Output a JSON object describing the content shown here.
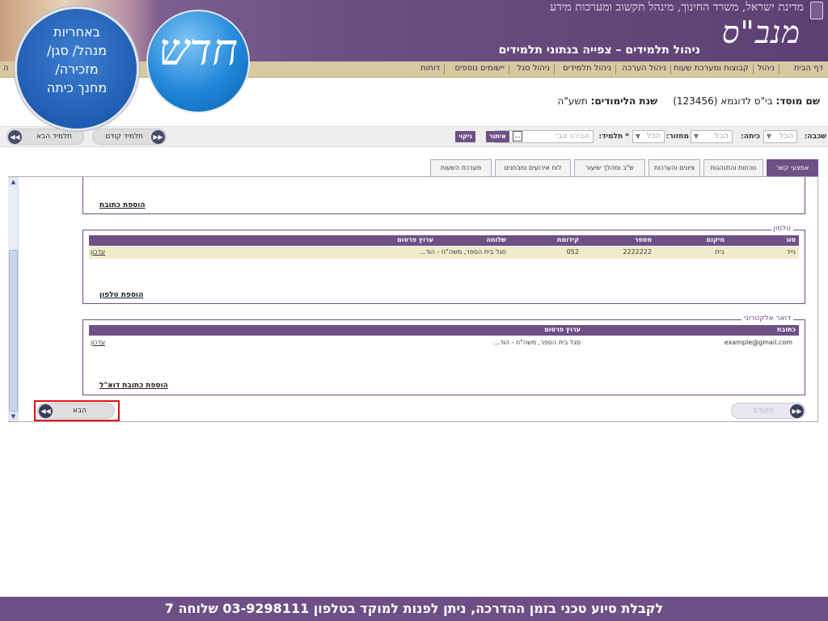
{
  "header": {
    "gov_line": "מדינת ישראל, משרד החינוך, מינהל תקשוב ומערכות מידע",
    "logo": "מנב\"ס",
    "subtitle": "ניהול תלמידים – צפייה בנתוני תלמידים"
  },
  "menu": {
    "items": [
      "דף הבית",
      "ניהול",
      "קבוצות ומערכת שעות",
      "ניהול הערכה",
      "ניהול תלמידים",
      "ניהול סגל",
      "יישומים נוספים",
      "דוחות",
      "ה"
    ]
  },
  "institution": {
    "inst_label": "שם מוסד:",
    "inst_value": "בי\"ס לדוגמא (123456)",
    "year_label": "שנת הלימודים:",
    "year_value": "תשע\"ה"
  },
  "filters": {
    "layer_label": "שכבה:",
    "layer_value": "הכל",
    "class_label": "כיתה:",
    "class_value": "הכל",
    "group_label": "מחזור:",
    "group_value": "הכל",
    "student_label": "* תלמיד:",
    "student_value": "אביהו אבי",
    "search_button": "איתור",
    "clear_button": "ניקוי",
    "dots": "..."
  },
  "student_nav": {
    "prev": "תלמיד קודם",
    "next": "תלמיד הבא"
  },
  "tabs": [
    "אמצעי קשר",
    "נוכחות והתנהגות",
    "ציונים והערכות",
    "ש\"ב ומהלך שיעור",
    "לוח אירועים ומבחנים",
    "מערכת השעות"
  ],
  "address_section": {
    "add_link": "הוספת כתובת"
  },
  "phone_section": {
    "legend": "טלפון",
    "columns": [
      "סוג",
      "מיקום",
      "מספר",
      "קידומת",
      "שלוחה",
      "ערוץ פרסום"
    ],
    "rows": [
      {
        "type": "נייד",
        "location": "בית",
        "number": "2222222",
        "prefix": "052",
        "ext": "",
        "channel": "סגל בית הספר, משה\"ח - הוד...",
        "action": "עדכון"
      }
    ],
    "add_link": "הוספת טלפון"
  },
  "email_section": {
    "legend": "דואר אלקטרוני",
    "columns": [
      "כתובת",
      "ערוץ פרסום"
    ],
    "rows": [
      {
        "address": "example@gmail.com",
        "channel": "סגל בית הספר, משה\"ח - הוד...",
        "action": "עדכון"
      }
    ],
    "add_link": "הוספת כתובת דוא\"ל"
  },
  "bottom_nav": {
    "prev": "הקודם",
    "next": "הבא"
  },
  "overlay": {
    "badge_lines": [
      "באחריות",
      "מנהל/ סגן/",
      "מזכירה/",
      "מחנך כיתה"
    ],
    "new_label": "חדש"
  },
  "footer": {
    "text": "לקבלת סיוע טכני בזמן ההדרכה, ניתן לפנות למוקד בטלפון 03-9298111 שלוחה 7"
  },
  "colors": {
    "brand_purple": "#6e4f86",
    "menu_bg": "#d9c9a0",
    "row_highlight": "#f1eacb",
    "annotation_red": "#e01010",
    "badge_blue": "#1f5eb3"
  }
}
